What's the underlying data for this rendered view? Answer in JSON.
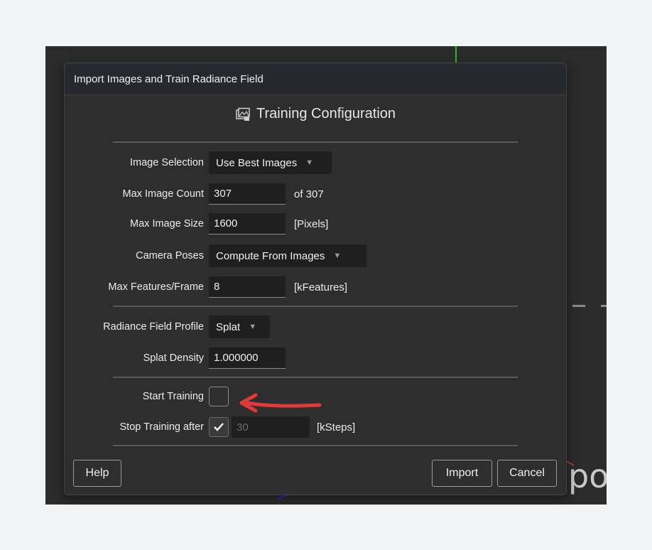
{
  "dialog": {
    "title": "Import Images and Train Radiance Field",
    "section_title": "Training Configuration",
    "section_icon": "image-config-icon"
  },
  "fields": {
    "image_selection": {
      "label": "Image Selection",
      "value": "Use Best Images"
    },
    "max_image_count": {
      "label": "Max Image Count",
      "value": "307",
      "suffix": "of 307"
    },
    "max_image_size": {
      "label": "Max Image Size",
      "value": "1600",
      "suffix": "[Pixels]"
    },
    "camera_poses": {
      "label": "Camera Poses",
      "value": "Compute From Images"
    },
    "max_features": {
      "label": "Max Features/Frame",
      "value": "8",
      "suffix": "[kFeatures]"
    },
    "radiance_profile": {
      "label": "Radiance Field Profile",
      "value": "Splat"
    },
    "splat_density": {
      "label": "Splat Density",
      "value": "1.000000"
    },
    "start_training": {
      "label": "Start Training",
      "checked": false
    },
    "stop_training": {
      "label": "Stop Training after",
      "checked": true,
      "value": "30",
      "suffix": "[kSteps]"
    }
  },
  "buttons": {
    "help": "Help",
    "import": "Import",
    "cancel": "Cancel"
  },
  "background": {
    "text": "po"
  },
  "colors": {
    "annotation_arrow": "#e03a3a",
    "dialog_bg": "#2e2e2e",
    "field_bg": "#1f1f1f"
  }
}
